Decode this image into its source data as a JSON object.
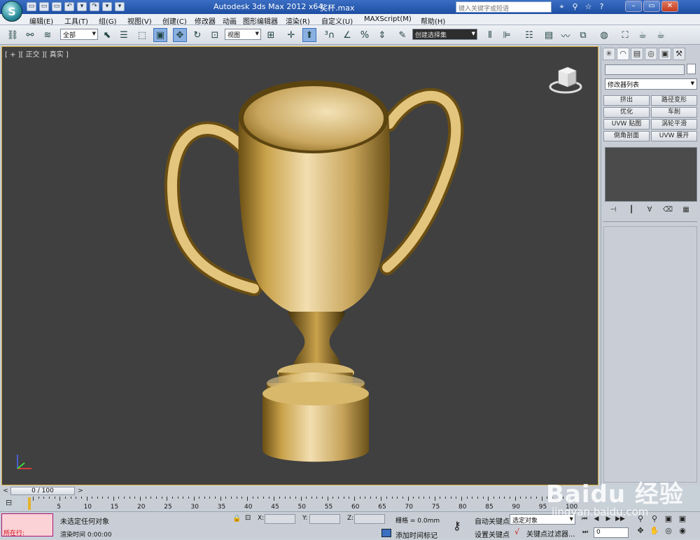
{
  "titlebar": {
    "logo": "S",
    "title": "Autodesk 3ds Max  2012 x64",
    "file": "奖杯.max",
    "search_placeholder": "键入关键字或短语",
    "quick_access": [
      "▭",
      "▭",
      "▭",
      "↶",
      "▾",
      "↷",
      "▾",
      "▾"
    ],
    "tools": [
      "⌖",
      "⚲",
      "☆",
      "?"
    ],
    "window_buttons": [
      "–",
      "▭",
      "✕"
    ]
  },
  "menu": [
    "编辑(E)",
    "工具(T)",
    "组(G)",
    "视图(V)",
    "创建(C)",
    "修改器",
    "动画",
    "图形编辑器",
    "渲染(R)",
    "自定义(U)",
    "MAXScript(M)",
    "帮助(H)"
  ],
  "toolbar": {
    "selection_filter": "全部",
    "reference_coord": "视图",
    "named_selection": "创建选择集"
  },
  "viewport": {
    "label": "[ + ][ 正交 ][ 真实 ]",
    "border_color": "#d7a93a",
    "background_color": "#404040",
    "object_color": "#c9a85a"
  },
  "cmdpanel": {
    "modifier_list": "修改器列表",
    "modifier_buttons": [
      "挤出",
      "路径变形",
      "优化",
      "车削",
      "UVW 贴图",
      "涡轮平滑",
      "倒角剖面",
      "UVW 展开"
    ],
    "tabs": [
      "✳",
      "◠",
      "▤",
      "◎",
      "▣",
      "⚒"
    ],
    "stack_buttons": [
      "⊣",
      "┃",
      "∀",
      "⌫",
      "▦"
    ]
  },
  "timeline": {
    "position": "0 / 100",
    "ticks": [
      "5",
      "10",
      "15",
      "20",
      "25",
      "30",
      "35",
      "40",
      "45",
      "50",
      "55",
      "60",
      "65",
      "70",
      "75",
      "80",
      "85",
      "90",
      "95",
      "100"
    ]
  },
  "status": {
    "maxscript_running": "所在行:",
    "prompt": "未选定任何对象",
    "render_time_label": "渲染时间",
    "render_time": "0:00:00",
    "x_label": "X:",
    "y_label": "Y:",
    "z_label": "Z:",
    "grid": "栅格 = 0.0mm",
    "add_time_tag": "添加时间标记",
    "auto_key": "自动关键点",
    "set_key": "设置关键点",
    "selected_object": "选定对象",
    "key_filters": "关键点过滤器...",
    "current_frame": "0",
    "playback": [
      "⏮",
      "◀",
      "▶",
      "▶▶",
      "⏭"
    ],
    "nav": [
      "⚲",
      "⚲",
      "▣",
      "▣",
      "✥",
      "✋",
      "◎",
      "◉"
    ]
  },
  "watermark": {
    "brand": "Baidu 经验",
    "url": "jingyan.baidu.com"
  }
}
